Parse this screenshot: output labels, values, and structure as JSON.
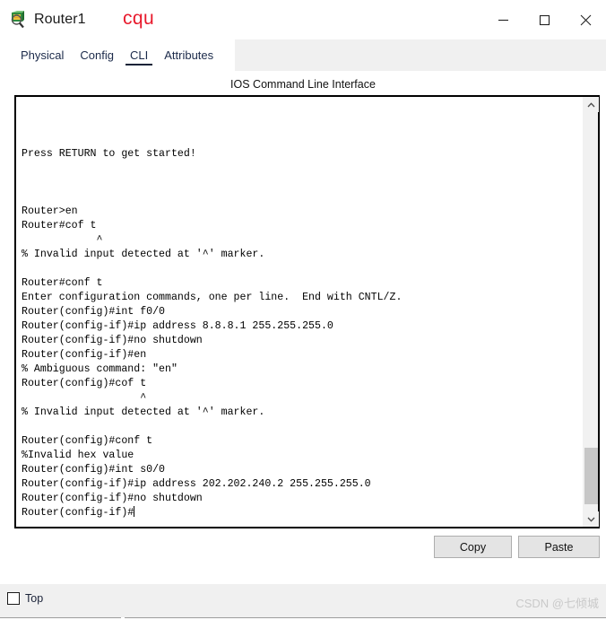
{
  "window": {
    "title": "Router1",
    "icon": "router-inspect-icon",
    "annotation": "cqu",
    "annotation_color": "#e8192c",
    "controls": {
      "minimize": "minimize-icon",
      "maximize": "maximize-icon",
      "close": "close-icon"
    }
  },
  "tabs": [
    {
      "label": "Physical",
      "active": false
    },
    {
      "label": "Config",
      "active": false
    },
    {
      "label": "CLI",
      "active": true
    },
    {
      "label": "Attributes",
      "active": false
    }
  ],
  "panel": {
    "header": "IOS Command Line Interface"
  },
  "terminal": {
    "lines": [
      "",
      "",
      "",
      "Press RETURN to get started!",
      "",
      "",
      "",
      "Router>en",
      "Router#cof t",
      "            ^",
      "% Invalid input detected at '^' marker.",
      "",
      "Router#conf t",
      "Enter configuration commands, one per line.  End with CNTL/Z.",
      "Router(config)#int f0/0",
      "Router(config-if)#ip address 8.8.8.1 255.255.255.0",
      "Router(config-if)#no shutdown",
      "Router(config-if)#en",
      "% Ambiguous command: \"en\"",
      "Router(config)#cof t",
      "                   ^",
      "% Invalid input detected at '^' marker.",
      "",
      "Router(config)#conf t",
      "%Invalid hex value",
      "Router(config)#int s0/0",
      "Router(config-if)#ip address 202.202.240.2 255.255.255.0",
      "Router(config-if)#no shutdown"
    ],
    "prompt": "Router(config-if)#",
    "scrollbar": {
      "up_arrow": "chevron-up-icon",
      "down_arrow": "chevron-down-icon",
      "thumb_position": "near-bottom"
    }
  },
  "actions": {
    "copy": "Copy",
    "paste": "Paste"
  },
  "status": {
    "top_checkbox_label": "Top",
    "top_checked": false,
    "watermark": "CSDN @七倾城"
  }
}
